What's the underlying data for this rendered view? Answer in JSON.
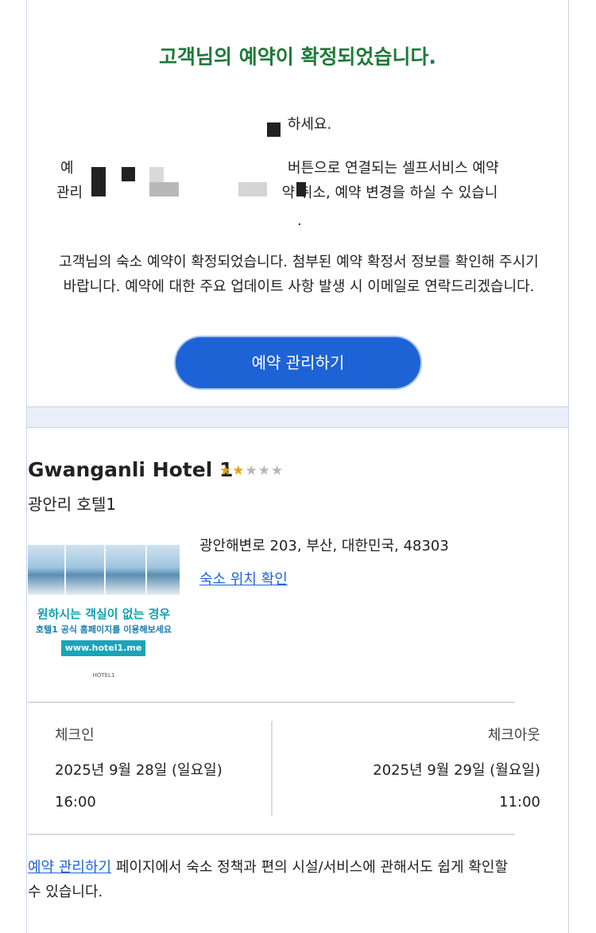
{
  "confirmation": {
    "headline": "고객님의 예약이 확정되었습니다.",
    "greeting_partial": "하세요.",
    "self_service_partial_line1_a": "예",
    "self_service_partial_line1_b": "버튼으로 연결되는 셀프서비스 예약",
    "self_service_partial_line2_a": "관리",
    "self_service_partial_line2_b": "약 취소, 예약 변경을 하실 수 있습니",
    "self_service_partial_line3": ".",
    "message": "고객님의 숙소 예약이 확정되었습니다. 첨부된 예약 확정서 정보를 확인해 주시기 바랍니다. 예약에 대한 주요 업데이트 사항 발생 시 이메일로 연락드리겠습니다.",
    "manage_button": "예약 관리하기"
  },
  "hotel": {
    "name": "Gwanganli Hotel 1",
    "rating": 2,
    "max_rating": 5,
    "subtitle": "광안리 호텔1",
    "address": "광안해변로 203, 부산, 대한민국, 48303",
    "map_link": "숙소 위치 확인",
    "ad_line1": "원하시는 객실이 없는 경우",
    "ad_line2": "호텔1 공식 홈페이지를 이용해보세요",
    "ad_url": "www.hotel1.me",
    "ad_logo": "HOTEL1"
  },
  "stay": {
    "checkin_label": "체크인",
    "checkin_date": "2025년 9월 28일 (일요일)",
    "checkin_time": "16:00",
    "checkout_label": "체크아웃",
    "checkout_date": "2025년 9월 29일 (월요일)",
    "checkout_time": "11:00"
  },
  "footer": {
    "link": "예약 관리하기",
    "text": " 페이지에서 숙소 정책과 편의 시설/서비스에 관해서도 쉽게 확인할 수 있습니다."
  },
  "colors": {
    "headline": "#1f7a3a",
    "button": "#1e63d6",
    "link": "#1e63d6",
    "star_on": "#e0a51a",
    "star_off": "#b7b7b7"
  }
}
